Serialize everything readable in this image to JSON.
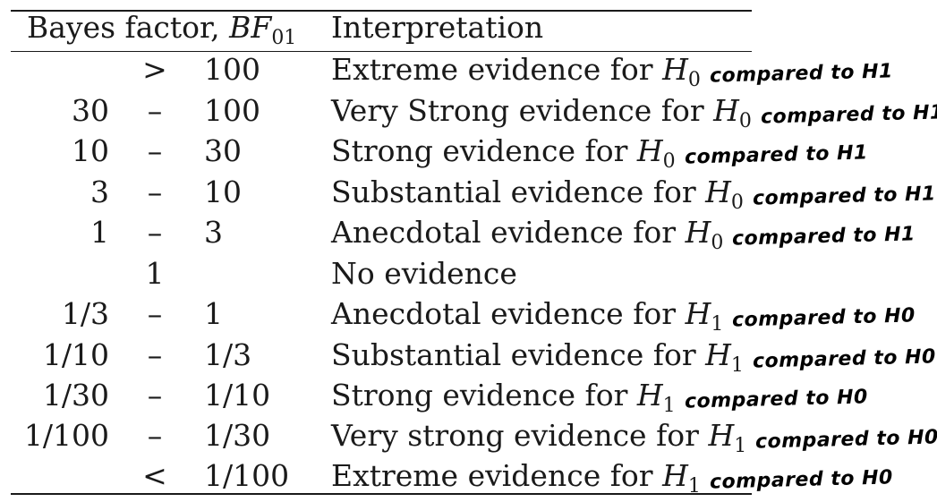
{
  "header": {
    "bf_label": "Bayes factor, ",
    "bf_symbol": "BF",
    "bf_sub": "01",
    "interp_label": "Interpretation"
  },
  "rows": [
    {
      "lo": "",
      "sym": ">",
      "hi": "100",
      "text": "Extreme evidence for ",
      "h": "H",
      "hsub": "0",
      "note": "compared to H1"
    },
    {
      "lo": "30",
      "sym": "–",
      "hi": "100",
      "text": "Very Strong evidence for ",
      "h": "H",
      "hsub": "0",
      "note": "compared to H1"
    },
    {
      "lo": "10",
      "sym": "–",
      "hi": "30",
      "text": "Strong evidence for ",
      "h": "H",
      "hsub": "0",
      "note": "compared to H1"
    },
    {
      "lo": "3",
      "sym": "–",
      "hi": "10",
      "text": "Substantial evidence for ",
      "h": "H",
      "hsub": "0",
      "note": "compared to H1"
    },
    {
      "lo": "1",
      "sym": "–",
      "hi": "3",
      "text": "Anecdotal evidence for ",
      "h": "H",
      "hsub": "0",
      "note": "compared to H1"
    },
    {
      "single": "1",
      "text": "No evidence"
    },
    {
      "lo": "1/3",
      "sym": "–",
      "hi": "1",
      "text": "Anecdotal evidence for ",
      "h": "H",
      "hsub": "1",
      "note": "compared to H0"
    },
    {
      "lo": "1/10",
      "sym": "–",
      "hi": "1/3",
      "text": "Substantial evidence for ",
      "h": "H",
      "hsub": "1",
      "note": "compared to H0"
    },
    {
      "lo": "1/30",
      "sym": "–",
      "hi": "1/10",
      "text": "Strong evidence for ",
      "h": "H",
      "hsub": "1",
      "note": "compared to H0"
    },
    {
      "lo": "1/100",
      "sym": "–",
      "hi": "1/30",
      "text": "Very strong evidence for ",
      "h": "H",
      "hsub": "1",
      "note": "compared to H0"
    },
    {
      "lo": "",
      "sym": "<",
      "hi": "1/100",
      "text": "Extreme evidence for ",
      "h": "H",
      "hsub": "1",
      "note": "compared to H0"
    }
  ]
}
